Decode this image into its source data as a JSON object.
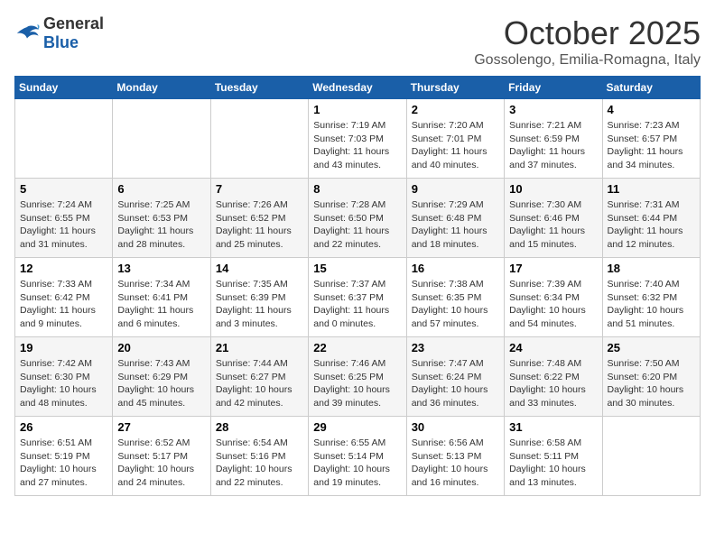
{
  "header": {
    "logo_general": "General",
    "logo_blue": "Blue",
    "month_title": "October 2025",
    "location": "Gossolengo, Emilia-Romagna, Italy"
  },
  "weekdays": [
    "Sunday",
    "Monday",
    "Tuesday",
    "Wednesday",
    "Thursday",
    "Friday",
    "Saturday"
  ],
  "weeks": [
    [
      {
        "day": "",
        "info": ""
      },
      {
        "day": "",
        "info": ""
      },
      {
        "day": "",
        "info": ""
      },
      {
        "day": "1",
        "info": "Sunrise: 7:19 AM\nSunset: 7:03 PM\nDaylight: 11 hours\nand 43 minutes."
      },
      {
        "day": "2",
        "info": "Sunrise: 7:20 AM\nSunset: 7:01 PM\nDaylight: 11 hours\nand 40 minutes."
      },
      {
        "day": "3",
        "info": "Sunrise: 7:21 AM\nSunset: 6:59 PM\nDaylight: 11 hours\nand 37 minutes."
      },
      {
        "day": "4",
        "info": "Sunrise: 7:23 AM\nSunset: 6:57 PM\nDaylight: 11 hours\nand 34 minutes."
      }
    ],
    [
      {
        "day": "5",
        "info": "Sunrise: 7:24 AM\nSunset: 6:55 PM\nDaylight: 11 hours\nand 31 minutes."
      },
      {
        "day": "6",
        "info": "Sunrise: 7:25 AM\nSunset: 6:53 PM\nDaylight: 11 hours\nand 28 minutes."
      },
      {
        "day": "7",
        "info": "Sunrise: 7:26 AM\nSunset: 6:52 PM\nDaylight: 11 hours\nand 25 minutes."
      },
      {
        "day": "8",
        "info": "Sunrise: 7:28 AM\nSunset: 6:50 PM\nDaylight: 11 hours\nand 22 minutes."
      },
      {
        "day": "9",
        "info": "Sunrise: 7:29 AM\nSunset: 6:48 PM\nDaylight: 11 hours\nand 18 minutes."
      },
      {
        "day": "10",
        "info": "Sunrise: 7:30 AM\nSunset: 6:46 PM\nDaylight: 11 hours\nand 15 minutes."
      },
      {
        "day": "11",
        "info": "Sunrise: 7:31 AM\nSunset: 6:44 PM\nDaylight: 11 hours\nand 12 minutes."
      }
    ],
    [
      {
        "day": "12",
        "info": "Sunrise: 7:33 AM\nSunset: 6:42 PM\nDaylight: 11 hours\nand 9 minutes."
      },
      {
        "day": "13",
        "info": "Sunrise: 7:34 AM\nSunset: 6:41 PM\nDaylight: 11 hours\nand 6 minutes."
      },
      {
        "day": "14",
        "info": "Sunrise: 7:35 AM\nSunset: 6:39 PM\nDaylight: 11 hours\nand 3 minutes."
      },
      {
        "day": "15",
        "info": "Sunrise: 7:37 AM\nSunset: 6:37 PM\nDaylight: 11 hours\nand 0 minutes."
      },
      {
        "day": "16",
        "info": "Sunrise: 7:38 AM\nSunset: 6:35 PM\nDaylight: 10 hours\nand 57 minutes."
      },
      {
        "day": "17",
        "info": "Sunrise: 7:39 AM\nSunset: 6:34 PM\nDaylight: 10 hours\nand 54 minutes."
      },
      {
        "day": "18",
        "info": "Sunrise: 7:40 AM\nSunset: 6:32 PM\nDaylight: 10 hours\nand 51 minutes."
      }
    ],
    [
      {
        "day": "19",
        "info": "Sunrise: 7:42 AM\nSunset: 6:30 PM\nDaylight: 10 hours\nand 48 minutes."
      },
      {
        "day": "20",
        "info": "Sunrise: 7:43 AM\nSunset: 6:29 PM\nDaylight: 10 hours\nand 45 minutes."
      },
      {
        "day": "21",
        "info": "Sunrise: 7:44 AM\nSunset: 6:27 PM\nDaylight: 10 hours\nand 42 minutes."
      },
      {
        "day": "22",
        "info": "Sunrise: 7:46 AM\nSunset: 6:25 PM\nDaylight: 10 hours\nand 39 minutes."
      },
      {
        "day": "23",
        "info": "Sunrise: 7:47 AM\nSunset: 6:24 PM\nDaylight: 10 hours\nand 36 minutes."
      },
      {
        "day": "24",
        "info": "Sunrise: 7:48 AM\nSunset: 6:22 PM\nDaylight: 10 hours\nand 33 minutes."
      },
      {
        "day": "25",
        "info": "Sunrise: 7:50 AM\nSunset: 6:20 PM\nDaylight: 10 hours\nand 30 minutes."
      }
    ],
    [
      {
        "day": "26",
        "info": "Sunrise: 6:51 AM\nSunset: 5:19 PM\nDaylight: 10 hours\nand 27 minutes."
      },
      {
        "day": "27",
        "info": "Sunrise: 6:52 AM\nSunset: 5:17 PM\nDaylight: 10 hours\nand 24 minutes."
      },
      {
        "day": "28",
        "info": "Sunrise: 6:54 AM\nSunset: 5:16 PM\nDaylight: 10 hours\nand 22 minutes."
      },
      {
        "day": "29",
        "info": "Sunrise: 6:55 AM\nSunset: 5:14 PM\nDaylight: 10 hours\nand 19 minutes."
      },
      {
        "day": "30",
        "info": "Sunrise: 6:56 AM\nSunset: 5:13 PM\nDaylight: 10 hours\nand 16 minutes."
      },
      {
        "day": "31",
        "info": "Sunrise: 6:58 AM\nSunset: 5:11 PM\nDaylight: 10 hours\nand 13 minutes."
      },
      {
        "day": "",
        "info": ""
      }
    ]
  ]
}
